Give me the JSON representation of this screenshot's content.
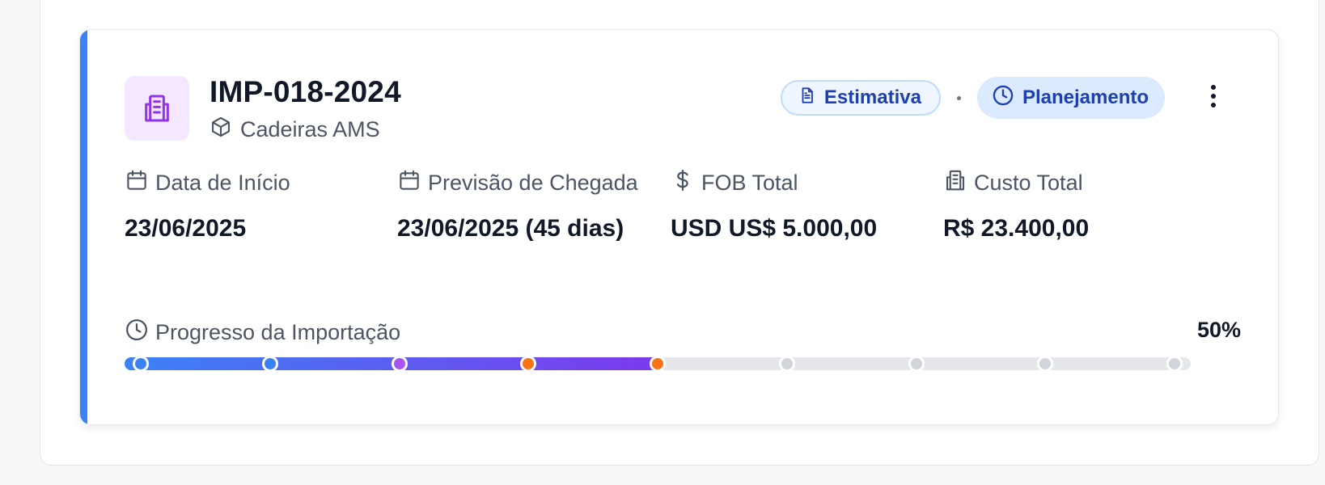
{
  "card": {
    "title": "IMP-018-2024",
    "product": "Cadeiras AMS",
    "product_icon": "package-icon",
    "import_icon": "building-icon",
    "accent_color": "#3b82f6",
    "badges": {
      "type_label": "Estimativa",
      "type_icon": "document-icon",
      "status_label": "Planejamento",
      "status_icon": "clock-icon"
    },
    "stats": [
      {
        "label": "Data de Início",
        "value": "23/06/2025",
        "icon": "calendar-icon"
      },
      {
        "label": "Previsão de Chegada",
        "value": "23/06/2025 (45 dias)",
        "icon": "calendar-icon"
      },
      {
        "label": "FOB Total",
        "value": "USD US$ 5.000,00",
        "icon": "dollar-icon"
      },
      {
        "label": "Custo Total",
        "value": "R$ 23.400,00",
        "icon": "receipt-icon"
      }
    ],
    "progress": {
      "label": "Progresso da Importação",
      "percent_text": "50%",
      "value": 0.5,
      "steps": [
        {
          "color": "#3b82f6",
          "done": true
        },
        {
          "color": "#3b82f6",
          "done": true
        },
        {
          "color": "#a855f7",
          "done": true
        },
        {
          "color": "#f97316",
          "done": true
        },
        {
          "color": "#f97316",
          "done": true
        },
        {
          "color": "#d1d5db",
          "done": false
        },
        {
          "color": "#d1d5db",
          "done": false
        },
        {
          "color": "#d1d5db",
          "done": false
        },
        {
          "color": "#d1d5db",
          "done": false
        }
      ]
    }
  }
}
